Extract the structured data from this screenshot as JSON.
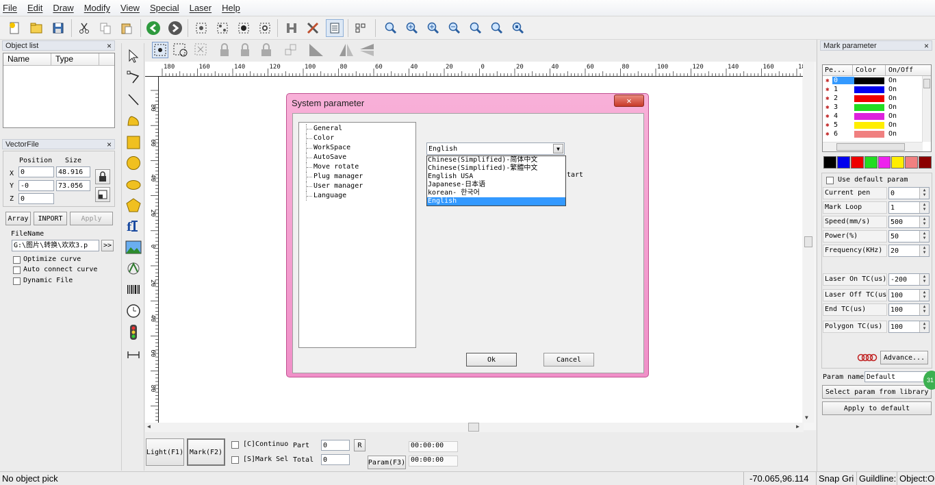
{
  "menu": [
    "File",
    "Edit",
    "Draw",
    "Modify",
    "View",
    "Special",
    "Laser",
    "Help"
  ],
  "object_list": {
    "title": "Object list",
    "close": "×",
    "columns": [
      "Name",
      "Type"
    ]
  },
  "vector_file": {
    "title": "VectorFile",
    "close": "×",
    "position_label": "Position",
    "size_label": "Size",
    "x_label": "X",
    "y_label": "Y",
    "z_label": "Z",
    "x_pos": "0",
    "x_size": "48.916",
    "y_pos": "-0",
    "y_size": "73.056",
    "z_pos": "0",
    "array": "Array",
    "inport": "INPORT",
    "apply": "Apply",
    "filename_label": "FileName",
    "filename": "G:\\图片\\转换\\欢欢3.p",
    "browse": ">>",
    "optimize": "Optimize curve",
    "auto_connect": "Auto connect curve",
    "dynamic": "Dynamic File"
  },
  "ruler": {
    "top": [
      "180",
      "160",
      "140",
      "120",
      "100",
      "80",
      "60",
      "40",
      "20",
      "0",
      "20",
      "40",
      "60",
      "80",
      "100",
      "120",
      "140",
      "160",
      "180"
    ],
    "left": [
      "80",
      "60",
      "40",
      "20",
      "0",
      "20",
      "40",
      "60",
      "80"
    ]
  },
  "dialog": {
    "title": "System parameter",
    "tree": [
      "General",
      "Color",
      "WorkSpace",
      "AutoSave",
      "Move rotate",
      "Plug manager",
      "User manager",
      "Language"
    ],
    "combo_value": "English",
    "options": [
      "Chinese(Simplified)-简体中文",
      "Chinese(Simplified)-繁體中文",
      "English USA",
      "Japanese-日本语",
      "korean- 한국어",
      "English"
    ],
    "selected_index": 5,
    "partial_label": "tart",
    "ok": "Ok",
    "cancel": "Cancel"
  },
  "bottom": {
    "light": "Light(F1)",
    "mark": "Mark(F2)",
    "continuo": "[C]Continuo",
    "mark_sel": "[S]Mark Sel",
    "part_label": "Part",
    "part": "0",
    "total_label": "Total",
    "total": "0",
    "r": "R",
    "param": "Param(F3)",
    "time1": "00:00:00",
    "time2": "00:00:00"
  },
  "status": {
    "left": "No object pick",
    "coords": "-70.065,96.114",
    "snap": "Snap Gri",
    "guideline": "Guildline:",
    "object": "Object:O"
  },
  "mark_param": {
    "title": "Mark parameter",
    "columns": [
      "Pe...",
      "Color",
      "On/Off"
    ],
    "pens": [
      {
        "id": "0",
        "color": "#000000",
        "state": "On"
      },
      {
        "id": "1",
        "color": "#0000ee",
        "state": "On"
      },
      {
        "id": "2",
        "color": "#ee0000",
        "state": "On"
      },
      {
        "id": "3",
        "color": "#22dd22",
        "state": "On"
      },
      {
        "id": "4",
        "color": "#dd22dd",
        "state": "On"
      },
      {
        "id": "5",
        "color": "#ffee00",
        "state": "On"
      },
      {
        "id": "6",
        "color": "#f08080",
        "state": "On"
      }
    ],
    "palette": [
      "#000000",
      "#0000ee",
      "#ee0000",
      "#22dd22",
      "#ee22ee",
      "#ffee00",
      "#f08080",
      "#8b0000"
    ],
    "use_default": "Use default param",
    "fields": [
      {
        "label": "Current pen",
        "value": "0"
      },
      {
        "label": "Mark Loop",
        "value": "1"
      },
      {
        "label": "Speed(mm/s)",
        "value": "500"
      },
      {
        "label": "Power(%)",
        "value": "50"
      },
      {
        "label": "Frequency(KHz)",
        "value": "20"
      }
    ],
    "fields2": [
      {
        "label": "Laser On TC(us)",
        "value": "-200"
      },
      {
        "label": "Laser Off TC(us",
        "value": "100"
      },
      {
        "label": "End TC(us)",
        "value": "100"
      },
      {
        "label": "Polygon TC(us)",
        "value": "100"
      }
    ],
    "advance": "Advance...",
    "param_name_label": "Param name",
    "param_name": "Default",
    "select_lib": "Select param from library",
    "apply_default": "Apply to default",
    "badge": "31"
  }
}
